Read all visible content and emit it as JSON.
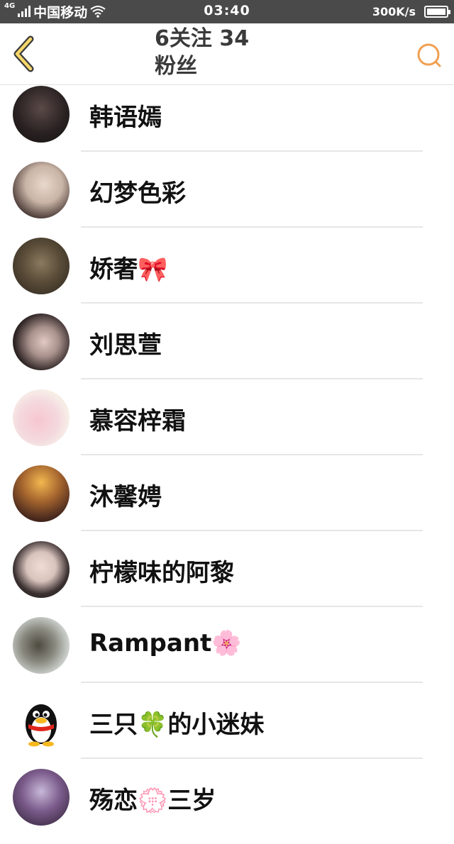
{
  "status_bar": {
    "network": "4G",
    "carrier": "中国移动",
    "time": "03:40",
    "speed": "300K/s"
  },
  "header": {
    "title": "6关注 34粉丝",
    "title_line1": "6关注 34",
    "title_line2": "粉丝",
    "back_icon": "chevron-left-icon",
    "search_icon": "search-icon",
    "accent_color": "#f0a050"
  },
  "followers": [
    {
      "name": "韩语嫣",
      "avatar": "avatar-photo"
    },
    {
      "name": "幻梦色彩",
      "avatar": "avatar-photo"
    },
    {
      "name": "娇奢🎀",
      "avatar": "avatar-photo"
    },
    {
      "name": "刘思萱",
      "avatar": "avatar-photo"
    },
    {
      "name": "慕容梓霜",
      "avatar": "avatar-photo"
    },
    {
      "name": "沐馨娉",
      "avatar": "avatar-photo"
    },
    {
      "name": "柠檬味的阿黎",
      "avatar": "avatar-photo"
    },
    {
      "name": "Rampant🌸",
      "avatar": "avatar-photo"
    },
    {
      "name": "三只🍀的小迷妹",
      "avatar": "qq-penguin-icon"
    },
    {
      "name": "殇恋💮三岁",
      "avatar": "avatar-photo"
    }
  ]
}
